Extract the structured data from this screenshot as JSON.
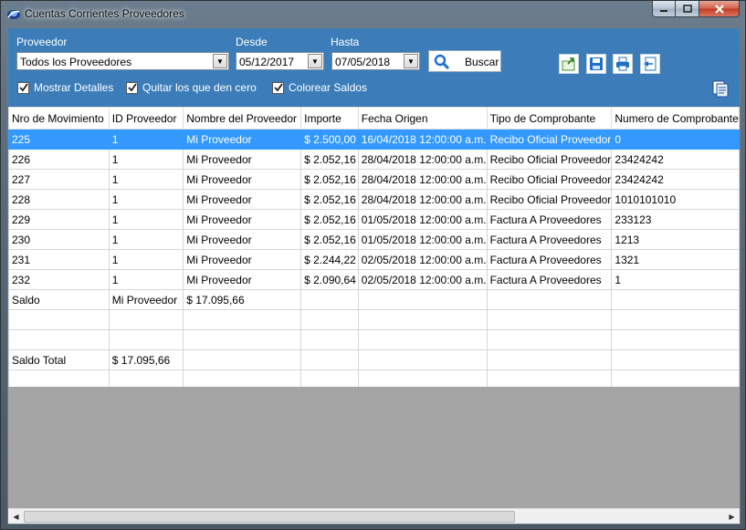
{
  "window": {
    "title": "Cuentas Corrientes Proveedores"
  },
  "filters": {
    "proveedor_label": "Proveedor",
    "proveedor_value": "Todos los Proveedores",
    "desde_label": "Desde",
    "desde_value": "05/12/2017",
    "hasta_label": "Hasta",
    "hasta_value": "07/05/2018",
    "search_label": "Buscar"
  },
  "options": [
    {
      "label": "Mostrar Detalles",
      "checked": true
    },
    {
      "label": "Quitar los que den cero",
      "checked": true
    },
    {
      "label": "Colorear Saldos",
      "checked": true
    }
  ],
  "toolbar": {
    "icons": [
      "export-excel-icon",
      "save-icon",
      "print-icon",
      "document-icon",
      "copy-pages-icon"
    ]
  },
  "colors": {
    "panel": "#3c7db9",
    "selected_row": "#3399ff"
  },
  "grid": {
    "columns": [
      "Nro de Movimiento",
      "ID Proveedor",
      "Nombre del Proveedor",
      "Importe",
      "Fecha Origen",
      "Tipo  de Comprobante",
      "Numero de Comprobante"
    ],
    "rows": [
      [
        "225",
        "1",
        "Mi Proveedor",
        "$ 2.500,00",
        "16/04/2018 12:00:00 a.m.",
        "Recibo Oficial Proveedor",
        "0"
      ],
      [
        "226",
        "1",
        "Mi Proveedor",
        "$ 2.052,16",
        "28/04/2018 12:00:00 a.m.",
        "Recibo Oficial Proveedor",
        "23424242"
      ],
      [
        "227",
        "1",
        "Mi Proveedor",
        "$ 2.052,16",
        "28/04/2018 12:00:00 a.m.",
        "Recibo Oficial Proveedor",
        "23424242"
      ],
      [
        "228",
        "1",
        "Mi Proveedor",
        "$ 2.052,16",
        "28/04/2018 12:00:00 a.m.",
        "Recibo Oficial Proveedor",
        "1010101010"
      ],
      [
        "229",
        "1",
        "Mi Proveedor",
        "$ 2.052,16",
        "01/05/2018 12:00:00 a.m.",
        "Factura A Proveedores",
        "233123"
      ],
      [
        "230",
        "1",
        "Mi Proveedor",
        "$ 2.052,16",
        "01/05/2018 12:00:00 a.m.",
        "Factura A Proveedores",
        "1213"
      ],
      [
        "231",
        "1",
        "Mi Proveedor",
        "$ 2.244,22",
        "02/05/2018 12:00:00 a.m.",
        "Factura A Proveedores",
        "1321"
      ],
      [
        "232",
        "1",
        "Mi Proveedor",
        "$ 2.090,64",
        "02/05/2018 12:00:00 a.m.",
        "Factura A Proveedores",
        "1"
      ],
      [
        "Saldo",
        "Mi Proveedor",
        "$ 17.095,66",
        "",
        "",
        "",
        ""
      ],
      [
        "",
        "",
        "",
        "",
        "",
        "",
        ""
      ],
      [
        "",
        "",
        "",
        "",
        "",
        "",
        ""
      ],
      [
        "Saldo Total",
        "$ 17.095,66",
        "",
        "",
        "",
        "",
        ""
      ],
      [
        "",
        "",
        "",
        "",
        "",
        "",
        ""
      ]
    ],
    "selected_row": 0
  }
}
